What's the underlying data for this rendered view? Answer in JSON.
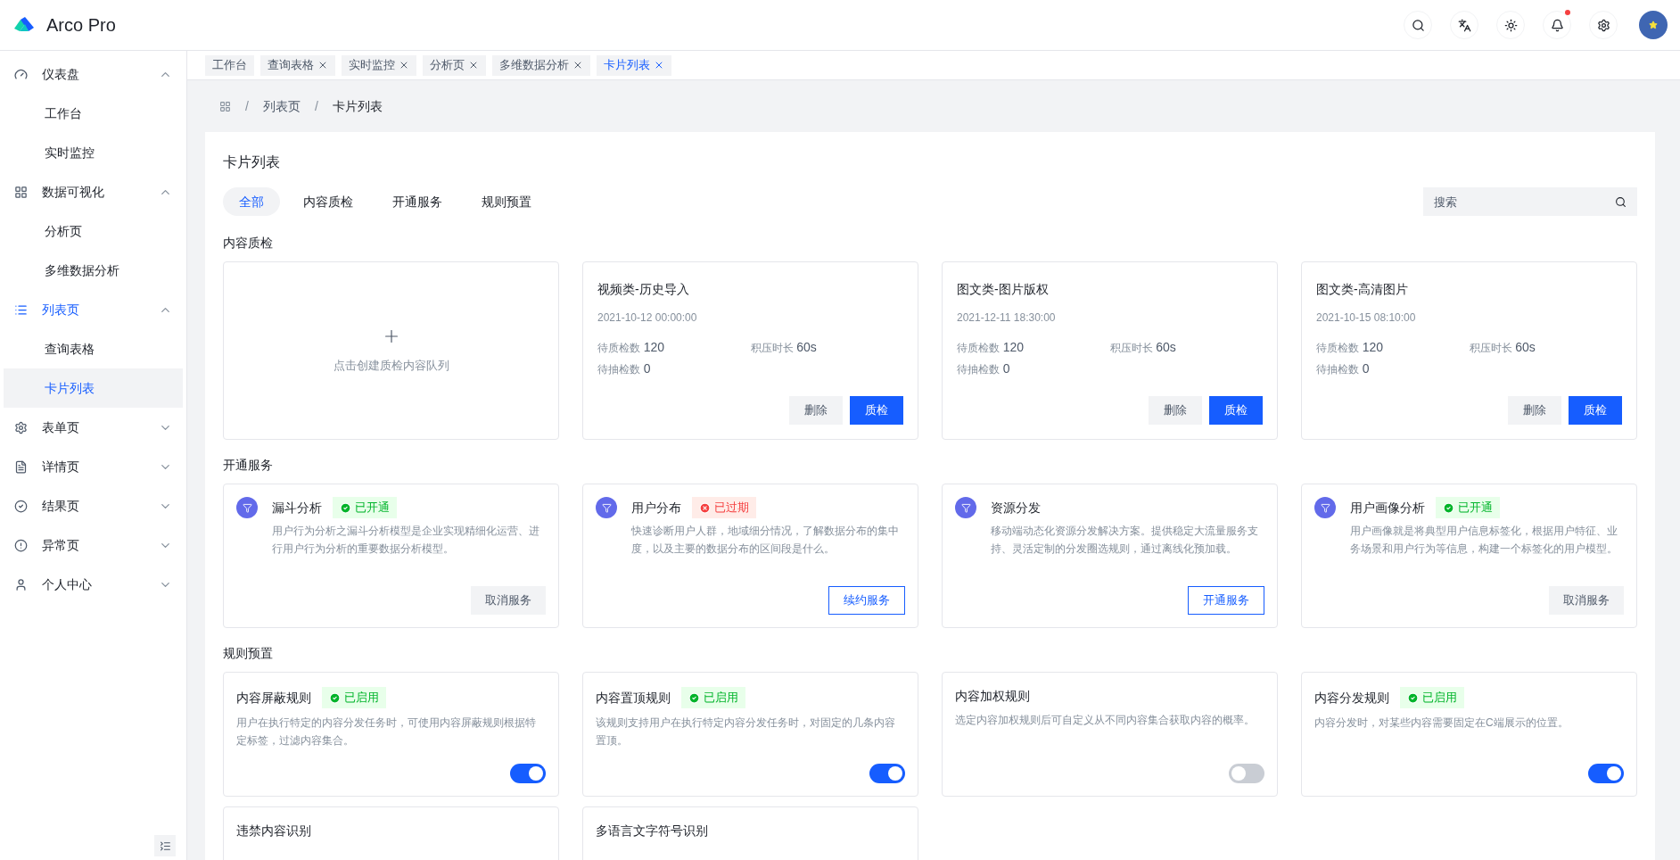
{
  "header": {
    "logo": "Arco Pro",
    "notification_dot": true
  },
  "sidebar": {
    "items": [
      {
        "label": "仪表盘",
        "expanded": true,
        "children": [
          {
            "label": "工作台",
            "selected": false
          },
          {
            "label": "实时监控",
            "selected": false
          }
        ]
      },
      {
        "label": "数据可视化",
        "expanded": true,
        "children": [
          {
            "label": "分析页",
            "selected": false
          },
          {
            "label": "多维数据分析",
            "selected": false
          }
        ]
      },
      {
        "label": "列表页",
        "expanded": true,
        "children": [
          {
            "label": "查询表格",
            "selected": false
          },
          {
            "label": "卡片列表",
            "selected": true
          }
        ]
      },
      {
        "label": "表单页",
        "expanded": false
      },
      {
        "label": "详情页",
        "expanded": false
      },
      {
        "label": "结果页",
        "expanded": false
      },
      {
        "label": "异常页",
        "expanded": false
      },
      {
        "label": "个人中心",
        "expanded": false
      }
    ]
  },
  "page_tabs": [
    {
      "label": "工作台",
      "closable": false,
      "selected": false
    },
    {
      "label": "查询表格",
      "closable": true,
      "selected": false
    },
    {
      "label": "实时监控",
      "closable": true,
      "selected": false
    },
    {
      "label": "分析页",
      "closable": true,
      "selected": false
    },
    {
      "label": "多维数据分析",
      "closable": true,
      "selected": false
    },
    {
      "label": "卡片列表",
      "closable": true,
      "selected": true
    }
  ],
  "breadcrumb": {
    "separator": "/",
    "items": [
      "列表页",
      "卡片列表"
    ]
  },
  "title": "卡片列表",
  "filter_tabs": [
    {
      "label": "全部",
      "selected": true
    },
    {
      "label": "内容质检",
      "selected": false
    },
    {
      "label": "开通服务",
      "selected": false
    },
    {
      "label": "规则预置",
      "selected": false
    }
  ],
  "search": {
    "placeholder": "搜索"
  },
  "quality": {
    "heading": "内容质检",
    "create_label": "点击创建质检内容队列",
    "cards": [
      {
        "title": "视频类-历史导入",
        "time": "2021-10-12 00:00:00",
        "stats": [
          {
            "label": "待质检数",
            "value": "120"
          },
          {
            "label": "积压时长",
            "value": "60s"
          },
          {
            "label": "待抽检数",
            "value": "0"
          }
        ],
        "buttons": [
          "删除",
          "质检"
        ]
      },
      {
        "title": "图文类-图片版权",
        "time": "2021-12-11 18:30:00",
        "stats": [
          {
            "label": "待质检数",
            "value": "120"
          },
          {
            "label": "积压时长",
            "value": "60s"
          },
          {
            "label": "待抽检数",
            "value": "0"
          }
        ],
        "buttons": [
          "删除",
          "质检"
        ]
      },
      {
        "title": "图文类-高清图片",
        "time": "2021-10-15 08:10:00",
        "stats": [
          {
            "label": "待质检数",
            "value": "120"
          },
          {
            "label": "积压时长",
            "value": "60s"
          },
          {
            "label": "待抽检数",
            "value": "0"
          }
        ],
        "buttons": [
          "删除",
          "质检"
        ]
      }
    ]
  },
  "services": {
    "heading": "开通服务",
    "cards": [
      {
        "title": "漏斗分析",
        "tag": {
          "text": "已开通",
          "kind": "success"
        },
        "description": "用户行为分析之漏斗分析模型是企业实现精细化运营、进行用户行为分析的重要数据分析模型。",
        "button": {
          "label": "取消服务",
          "kind": "secondary"
        }
      },
      {
        "title": "用户分布",
        "tag": {
          "text": "已过期",
          "kind": "danger"
        },
        "description": "快速诊断用户人群，地域细分情况，了解数据分布的集中度，以及主要的数据分布的区间段是什么。",
        "button": {
          "label": "续约服务",
          "kind": "outline"
        }
      },
      {
        "title": "资源分发",
        "description": "移动端动态化资源分发解决方案。提供稳定大流量服务支持、灵活定制的分发圈选规则，通过离线化预加载。",
        "button": {
          "label": "开通服务",
          "kind": "outline"
        }
      },
      {
        "title": "用户画像分析",
        "tag": {
          "text": "已开通",
          "kind": "success"
        },
        "description": "用户画像就是将典型用户信息标签化，根据用户特征、业务场景和用户行为等信息，构建一个标签化的用户模型。",
        "button": {
          "label": "取消服务",
          "kind": "secondary"
        }
      }
    ]
  },
  "rules": {
    "heading": "规则预置",
    "cards": [
      {
        "title": "内容屏蔽规则",
        "tag": {
          "text": "已启用",
          "kind": "success"
        },
        "description": "用户在执行特定的内容分发任务时，可使用内容屏蔽规则根据特定标签，过滤内容集合。",
        "on": true
      },
      {
        "title": "内容置顶规则",
        "tag": {
          "text": "已启用",
          "kind": "success"
        },
        "description": "该规则支持用户在执行特定内容分发任务时，对固定的几条内容置顶。",
        "on": true
      },
      {
        "title": "内容加权规则",
        "description": "选定内容加权规则后可自定义从不同内容集合获取内容的概率。",
        "on": false
      },
      {
        "title": "内容分发规则",
        "tag": {
          "text": "已启用",
          "kind": "success"
        },
        "description": "内容分发时，对某些内容需要固定在C端展示的位置。",
        "on": true
      },
      {
        "title": "违禁内容识别"
      },
      {
        "title": "多语言文字符号识别"
      }
    ]
  }
}
